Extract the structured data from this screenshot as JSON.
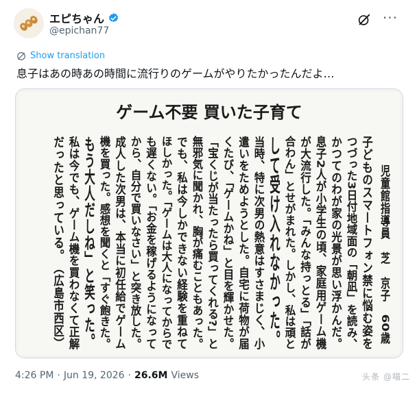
{
  "account": {
    "display_name": "エピちゃん",
    "handle": "@epichan77"
  },
  "tweet": {
    "show_translation": "Show translation",
    "text": "息子はあの時あの時間に流行りのゲームがやりたかったんだよ…"
  },
  "article": {
    "headline": "ゲーム不要 買いた子育て",
    "byline": "児童館指導員　芝　京子　60歳",
    "columns": [
      "子どものスマートフォン禁に悩む姿を",
      "つづった3日付地域面の「朝凪」を読み、",
      "かつてのわが家の光景が思い浮かんだ。",
      "息子2人が小学生の頃、家庭用ゲーム機",
      "が大流行した。「みんな持っとる」「話が",
      "合わん」とせがまれた。しかし、私は頑と",
      "して受け入れなかった。",
      "当時、特に次男の熱意はすさまじく、小",
      "遣いをためようとした。自宅に荷物が届",
      "くたび、「ゲームかね」と目を輝かせた。",
      "「宝くじが当たったら買ってくれる?」と",
      "無邪気に聞かれ、胸が痛むこともあった。",
      "でも、私は今しかできない経験を重ねて",
      "ほしかった。「ゲームは大人になってからで",
      "も遅くない。「お金を稼げるようになって",
      "から、自分で買いなさい」と突き放した。",
      "成人した次男は、本当に初任給でゲーム",
      "機を買った。感想を聞くと「すぐ飽きた。",
      "もう大人だしね」と笑った。",
      "私は今でも、ゲーム機を買わなくて正解",
      "だったと思っている。　（広島市西区）"
    ]
  },
  "meta": {
    "time": "4:26 PM",
    "separator": "·",
    "date": "Jun 19, 2026",
    "views_count": "26.6M",
    "views_label": "Views"
  },
  "watermark": "头条 @喵二"
}
